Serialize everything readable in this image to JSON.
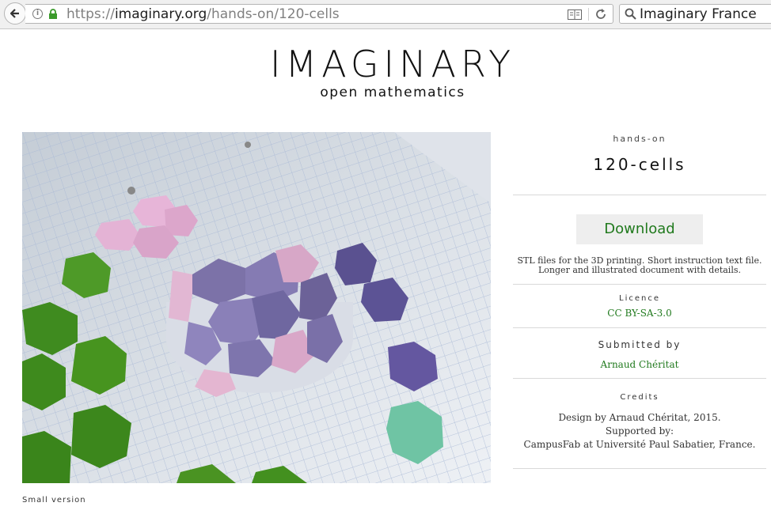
{
  "browser": {
    "url_prefix": "https://",
    "url_host": "imaginary.org",
    "url_path": "/hands-on/120-cells",
    "search_value": "Imaginary France",
    "icons": [
      "back-arrow-icon",
      "info-icon",
      "lock-icon",
      "reader-view-icon",
      "reload-icon",
      "search-icon"
    ]
  },
  "logo": {
    "word": "IMAGINARY",
    "tagline": "open mathematics"
  },
  "photo": {
    "caption": "Small version"
  },
  "sidebar": {
    "kicker": "hands-on",
    "title": "120-cells",
    "download_label": "Download",
    "download_description": "STL files for the 3D printing. Short instruction text file. Longer and illustrated document with details.",
    "licence_label": "Licence",
    "licence_value": "CC BY-SA-3.0",
    "submitted_label": "Submitted by",
    "submitted_value": "Arnaud Chéritat",
    "credits_label": "Credits",
    "credits_lines": [
      "Design by Arnaud Chéritat, 2015.",
      "Supported by:",
      "CampusFab at Université Paul Sabatier, France."
    ]
  },
  "colors": {
    "link_green": "#217a1e",
    "button_bg": "#eeeeee",
    "rule": "#d9d9d9"
  }
}
